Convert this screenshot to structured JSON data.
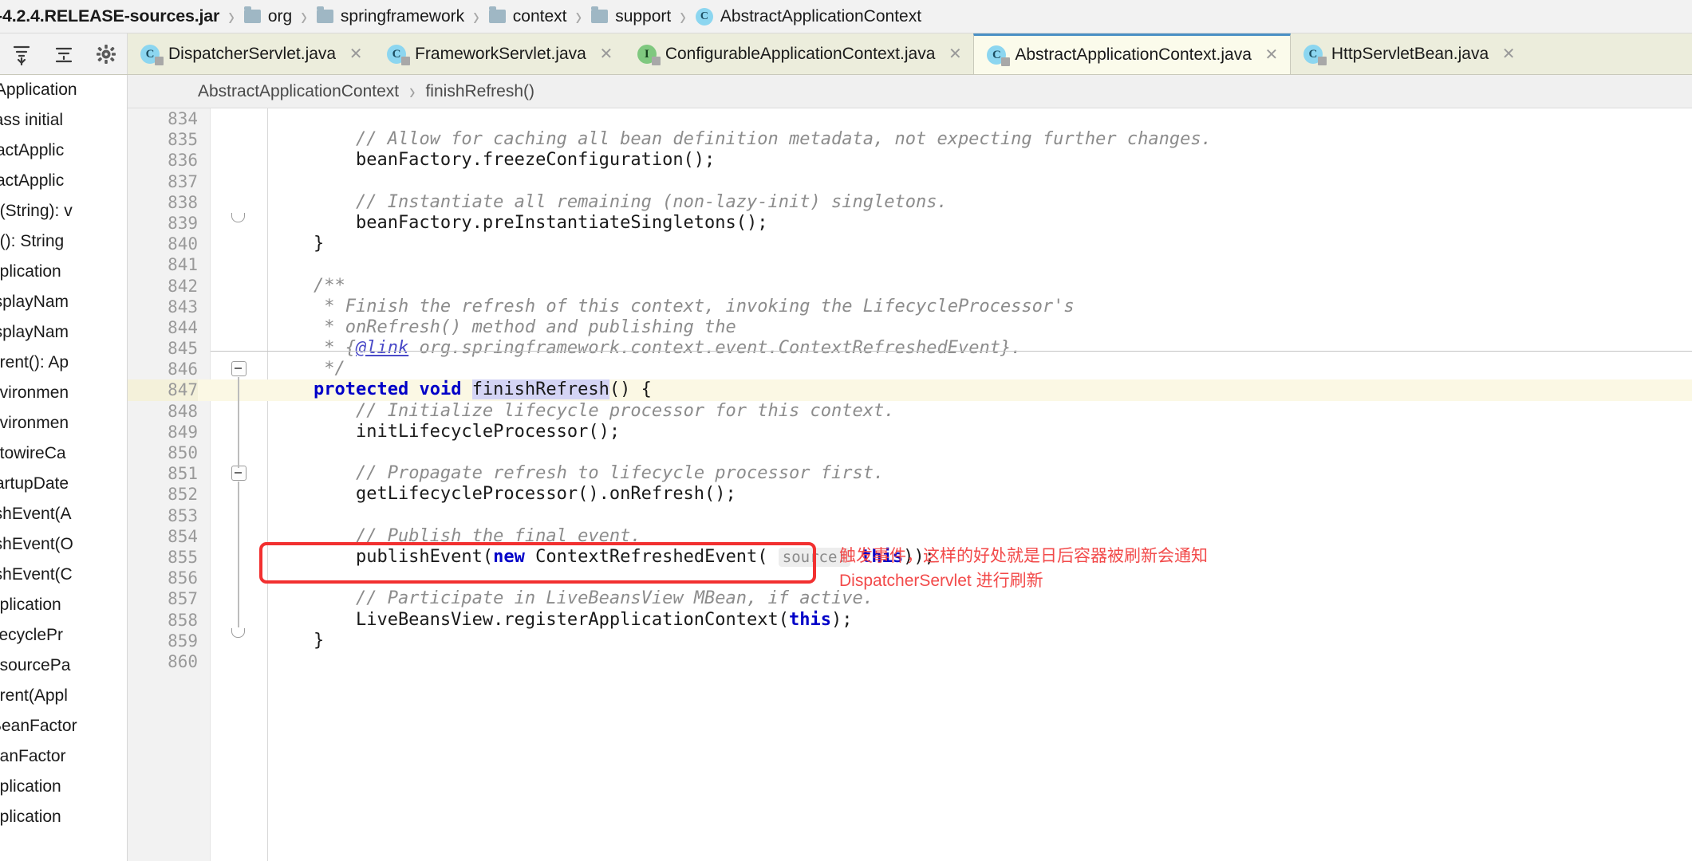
{
  "window": {
    "breadcrumb": [
      {
        "label": "-4.2.4.RELEASE-sources.jar",
        "icon": "jar-icon",
        "type": "jar"
      },
      {
        "label": "org",
        "icon": "folder-icon",
        "type": "folder"
      },
      {
        "label": "springframework",
        "icon": "folder-icon",
        "type": "folder"
      },
      {
        "label": "context",
        "icon": "folder-icon",
        "type": "folder"
      },
      {
        "label": "support",
        "icon": "folder-icon",
        "type": "folder"
      },
      {
        "label": "AbstractApplicationContext",
        "icon": "class-icon",
        "type": "class"
      }
    ],
    "separator": "›"
  },
  "toolbar": {
    "icons": [
      {
        "name": "expand-all-icon",
        "title": "Expand All"
      },
      {
        "name": "collapse-all-icon",
        "title": "Collapse All"
      },
      {
        "name": "settings-gear-icon",
        "title": "Settings"
      }
    ]
  },
  "tabs": [
    {
      "label": "DispatcherServlet.java",
      "icon": "java-class-icon",
      "kind": "class",
      "active": false,
      "close": "✕"
    },
    {
      "label": "FrameworkServlet.java",
      "icon": "java-class-icon",
      "kind": "class",
      "active": false,
      "close": "✕"
    },
    {
      "label": "ConfigurableApplicationContext.java",
      "icon": "java-interface-icon",
      "kind": "interface",
      "active": false,
      "close": "✕"
    },
    {
      "label": "AbstractApplicationContext.java",
      "icon": "java-class-icon",
      "kind": "class",
      "active": true,
      "close": "✕"
    },
    {
      "label": "HttpServletBean.java",
      "icon": "java-class-icon",
      "kind": "class",
      "active": false,
      "close": "✕"
    }
  ],
  "method_breadcrumb": {
    "class": "AbstractApplicationContext",
    "separator": "›",
    "method": "finishRefresh()"
  },
  "structure_sidebar": {
    "items": [
      "tApplication",
      "lass initial",
      "ractApplic",
      "ractApplic",
      "d(String): v",
      "d(): String",
      "pplication",
      "isplayNam",
      "isplayNam",
      "arent(): Ap",
      "nvironmen",
      "nvironmen",
      "utowireCa",
      "tartupDate",
      "ishEvent(A",
      "ishEvent(O",
      "ishEvent(C",
      "pplication",
      "ifecyclePr",
      "esourcePа",
      "arent(Appl",
      "BeanFactor",
      "eanFactor",
      "pplication",
      "pplication"
    ]
  },
  "editor": {
    "first_line": 834,
    "highlight_line": 847,
    "lines": [
      {
        "n": 834,
        "text": ""
      },
      {
        "n": 835,
        "text": "        // Allow for caching all bean definition metadata, not expecting further changes."
      },
      {
        "n": 836,
        "text": "        beanFactory.freezeConfiguration();"
      },
      {
        "n": 837,
        "text": ""
      },
      {
        "n": 838,
        "text": "        // Instantiate all remaining (non-lazy-init) singletons."
      },
      {
        "n": 839,
        "text": "        beanFactory.preInstantiateSingletons();"
      },
      {
        "n": 840,
        "text": "    }"
      },
      {
        "n": 841,
        "text": ""
      },
      {
        "n": 842,
        "text": "    /**"
      },
      {
        "n": 843,
        "text": "     * Finish the refresh of this context, invoking the LifecycleProcessor's"
      },
      {
        "n": 844,
        "text": "     * onRefresh() method and publishing the"
      },
      {
        "n": 845,
        "text": "     * {@link org.springframework.context.event.ContextRefreshedEvent}."
      },
      {
        "n": 846,
        "text": "     */"
      },
      {
        "n": 847,
        "text": "    protected void finishRefresh() {"
      },
      {
        "n": 848,
        "text": "        // Initialize lifecycle processor for this context."
      },
      {
        "n": 849,
        "text": "        initLifecycleProcessor();"
      },
      {
        "n": 850,
        "text": ""
      },
      {
        "n": 851,
        "text": "        // Propagate refresh to lifecycle processor first."
      },
      {
        "n": 852,
        "text": "        getLifecycleProcessor().onRefresh();"
      },
      {
        "n": 853,
        "text": ""
      },
      {
        "n": 854,
        "text": "        // Publish the final event."
      },
      {
        "n": 855,
        "text": "        publishEvent(new ContextRefreshedEvent( source: this));"
      },
      {
        "n": 856,
        "text": ""
      },
      {
        "n": 857,
        "text": "        // Participate in LiveBeansView MBean, if active."
      },
      {
        "n": 858,
        "text": "        LiveBeansView.registerApplicationContext(this);"
      },
      {
        "n": 859,
        "text": "    }"
      },
      {
        "n": 860,
        "text": ""
      }
    ],
    "parameter_hint": "source:",
    "keywords": [
      "protected",
      "void",
      "new",
      "this"
    ],
    "javadoc_link": "@link",
    "caret_line": 847,
    "selected_text": "finishRefresh"
  },
  "annotation": {
    "color": "#f24a4a",
    "box_line": 855,
    "text": "触发事件，这样的好处就是日后容器被刷新会通知\nDispatcherServlet 进行刷新"
  },
  "colors": {
    "accent": "#4a90c4",
    "tab_active_bg": "#fbfbeb",
    "tab_bg": "#eceddc",
    "annotation_red": "#f23030",
    "keyword_blue": "#0000c8",
    "comment_gray": "#8c8c8c",
    "highlight_row": "#fbf8e4"
  }
}
